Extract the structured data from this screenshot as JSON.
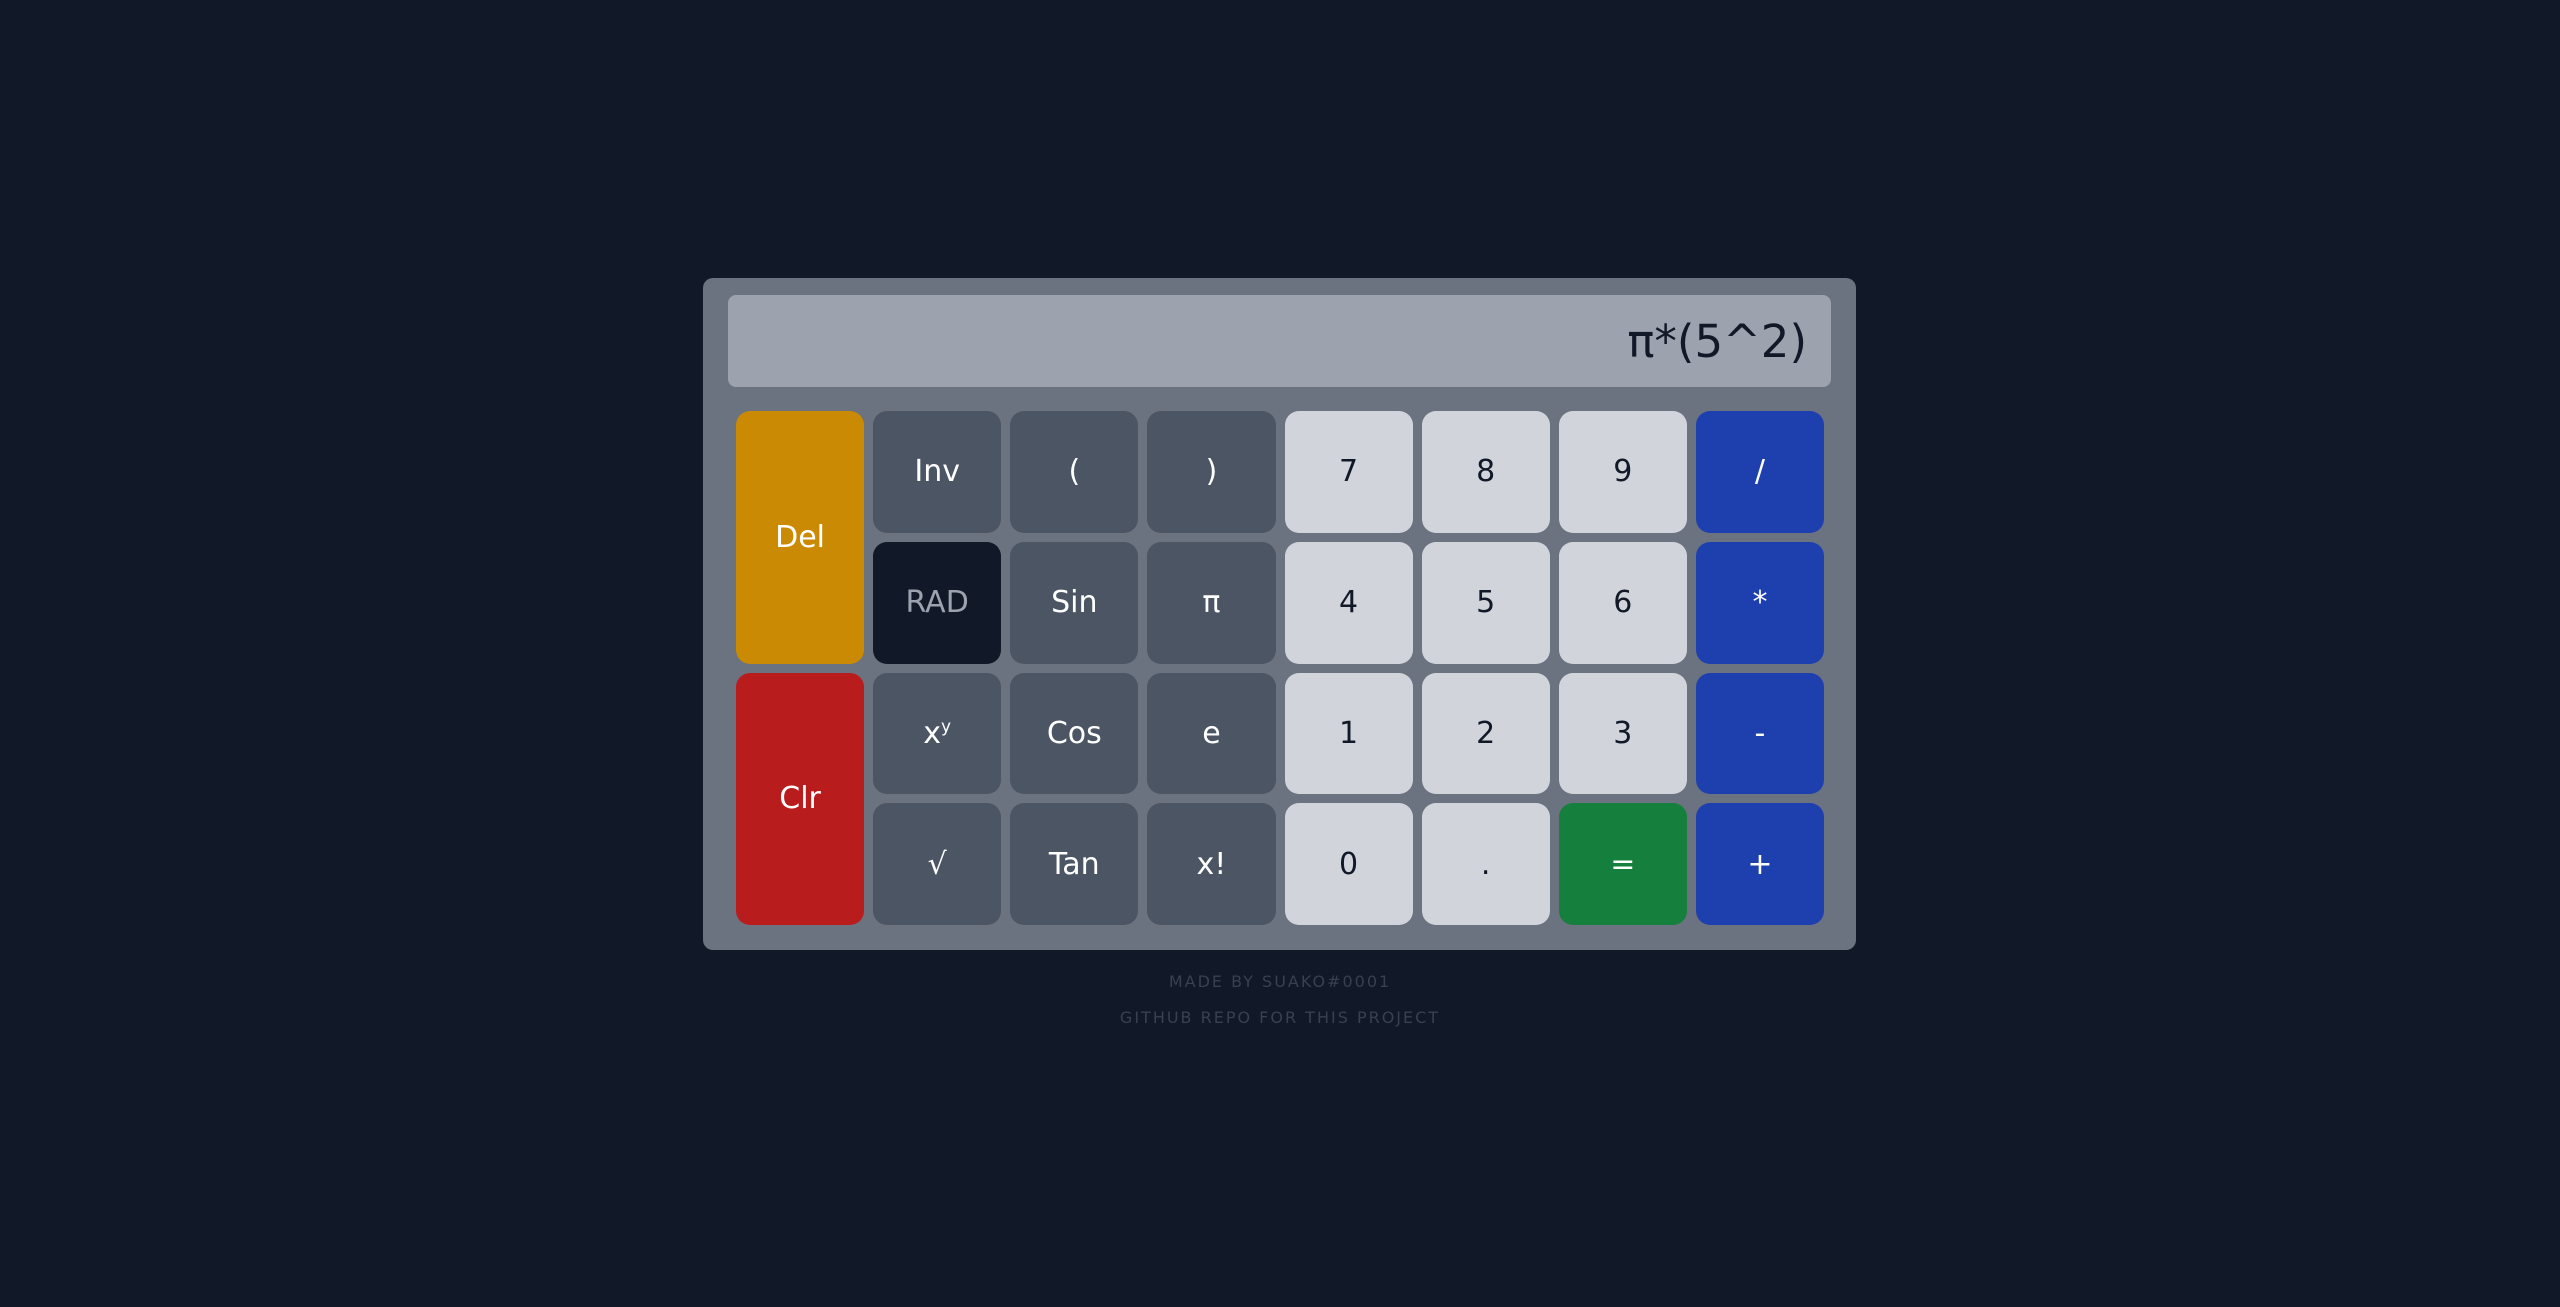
{
  "display": {
    "expression": "π*(5^2)"
  },
  "keys": {
    "del": "Del",
    "clr": "Clr",
    "inv": "Inv",
    "open_paren": "(",
    "close_paren": ")",
    "rad": "RAD",
    "sin": "Sin",
    "pi": "π",
    "pow_base": "x",
    "pow_exp": "y",
    "cos": "Cos",
    "e": "e",
    "sqrt": "√",
    "tan": "Tan",
    "factorial": "x!",
    "n7": "7",
    "n8": "8",
    "n9": "9",
    "n4": "4",
    "n5": "5",
    "n6": "6",
    "n1": "1",
    "n2": "2",
    "n3": "3",
    "n0": "0",
    "dot": ".",
    "equals": "=",
    "divide": "/",
    "multiply": "*",
    "minus": "-",
    "plus": "+"
  },
  "footer": {
    "credit": "MADE BY SUAKO#0001",
    "repo_link": "GITHUB REPO FOR THIS PROJECT"
  },
  "colors": {
    "background": "#111827",
    "calculator_body": "#6b7280",
    "display": "#9ca3af",
    "del": "#ca8a04",
    "clr": "#b91c1c",
    "function_key": "#4b5563",
    "rad_key": "#111827",
    "number_key": "#d1d5db",
    "operator_key": "#1e40af",
    "equals_key": "#15803d"
  }
}
